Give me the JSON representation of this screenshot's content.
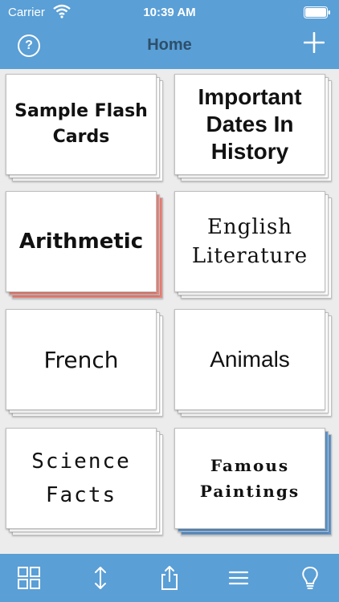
{
  "status_bar": {
    "carrier": "Carrier",
    "time": "10:39 AM"
  },
  "nav": {
    "title": "Home",
    "help_label": "?"
  },
  "decks": [
    {
      "title": "Sample Flash Cards",
      "style": "lined"
    },
    {
      "title": "Important Dates In History",
      "style": "plain"
    },
    {
      "title": "Arithmetic",
      "style": "red"
    },
    {
      "title": "English Literature",
      "style": "plain"
    },
    {
      "title": "French",
      "style": "lined"
    },
    {
      "title": "Animals",
      "style": "plain"
    },
    {
      "title": "Science Facts",
      "style": "grid"
    },
    {
      "title": "Famous Paintings",
      "style": "blue"
    }
  ],
  "tabbar": {
    "icons": [
      "grid-icon",
      "sort-arrows-icon",
      "share-icon",
      "menu-icon",
      "lightbulb-icon"
    ]
  },
  "colors": {
    "accent": "#5a9fd6",
    "title_text": "#2d4f6b"
  }
}
